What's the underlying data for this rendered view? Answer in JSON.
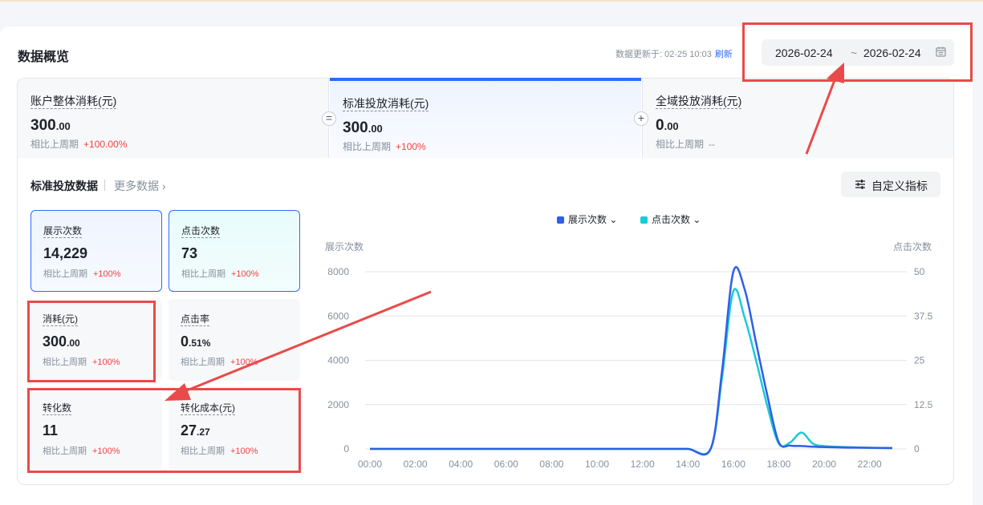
{
  "header": {
    "title": "数据概览",
    "updated_label": "数据更新于:",
    "updated_time": "02-25 10:03",
    "refresh_label": "刷新"
  },
  "date_range": {
    "start": "2026-02-24",
    "separator": "~",
    "end": "2026-02-24"
  },
  "summary_cards": [
    {
      "label": "账户整体消耗(元)",
      "int": "300",
      "dec": ".00",
      "cmp_label": "相比上周期",
      "cmp_value": "+100.00%"
    },
    {
      "label": "标准投放消耗(元)",
      "int": "300",
      "dec": ".00",
      "cmp_label": "相比上周期",
      "cmp_value": "+100%"
    },
    {
      "label": "全域投放消耗(元)",
      "int": "0",
      "dec": ".00",
      "cmp_label": "相比上周期",
      "cmp_value": "--"
    }
  ],
  "operators": {
    "equals": "=",
    "plus": "+"
  },
  "section": {
    "title": "标准投放数据",
    "more": "更多数据",
    "more_arrow": "›",
    "custom_button": "自定义指标"
  },
  "kpis": [
    {
      "label": "展示次数",
      "int": "14,229",
      "dec": "",
      "cmp_label": "相比上周期",
      "cmp_value": "+100%"
    },
    {
      "label": "点击次数",
      "int": "73",
      "dec": "",
      "cmp_label": "相比上周期",
      "cmp_value": "+100%"
    },
    {
      "label": "消耗(元)",
      "int": "300",
      "dec": ".00",
      "cmp_label": "相比上周期",
      "cmp_value": "+100%"
    },
    {
      "label": "点击率",
      "int": "0",
      "dec": ".51%",
      "cmp_label": "相比上周期",
      "cmp_value": "+100%"
    },
    {
      "label": "转化数",
      "int": "11",
      "dec": "",
      "cmp_label": "相比上周期",
      "cmp_value": "+100%"
    },
    {
      "label": "转化成本(元)",
      "int": "27",
      "dec": ".27",
      "cmp_label": "相比上周期",
      "cmp_value": "+100%"
    }
  ],
  "colors": {
    "accent": "#2f6bff",
    "impressions": "#2f5ee8",
    "clicks": "#19cbd6",
    "up": "#f53f3f",
    "annotation": "#ea4a4a"
  },
  "chart_data": {
    "type": "line",
    "title": "",
    "legend": [
      "展示次数",
      "点击次数"
    ],
    "legend_position": "top-center",
    "y_left_label": "展示次数",
    "y_right_label": "点击次数",
    "y_left_ticks": [
      "8000",
      "6000",
      "4000",
      "2000",
      "0"
    ],
    "y_right_ticks": [
      "50",
      "37.5",
      "25",
      "12.5",
      "0"
    ],
    "ylim_left": [
      0,
      8000
    ],
    "ylim_right": [
      0,
      50
    ],
    "x_ticks": [
      "00:00",
      "02:00",
      "04:00",
      "06:00",
      "08:00",
      "10:00",
      "12:00",
      "14:00",
      "16:00",
      "18:00",
      "20:00",
      "22:00"
    ],
    "x_hours": [
      0,
      1,
      2,
      3,
      4,
      5,
      6,
      7,
      8,
      9,
      10,
      11,
      12,
      13,
      14,
      15,
      15.5,
      16,
      16.5,
      17,
      17.5,
      18,
      18.5,
      19,
      19.5,
      20,
      21,
      22,
      23
    ],
    "series": [
      {
        "name": "展示次数",
        "axis": "left",
        "values": [
          0,
          0,
          0,
          0,
          0,
          0,
          0,
          0,
          0,
          0,
          0,
          0,
          0,
          0,
          0,
          0,
          3500,
          8000,
          7200,
          4800,
          2400,
          300,
          150,
          130,
          100,
          80,
          60,
          50,
          40
        ]
      },
      {
        "name": "点击次数",
        "axis": "right",
        "values": [
          0,
          0,
          0,
          0,
          0,
          0,
          0,
          0,
          0,
          0,
          0,
          0,
          0,
          0,
          0,
          0,
          20,
          44.5,
          37,
          25,
          12,
          1.5,
          1.8,
          4.6,
          1.5,
          0.8,
          0.5,
          0.3,
          0.2
        ]
      }
    ]
  }
}
